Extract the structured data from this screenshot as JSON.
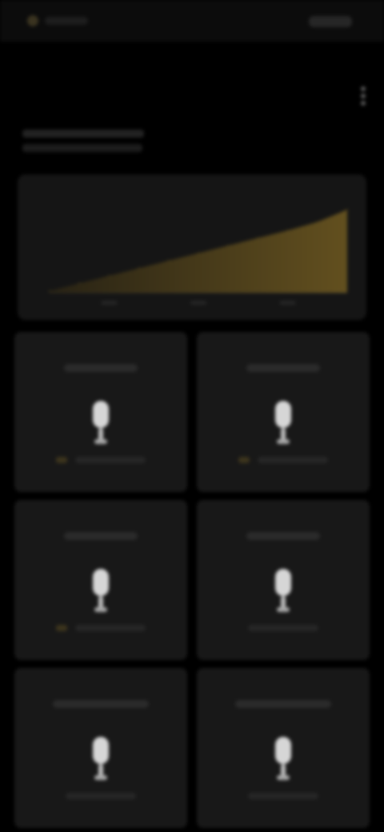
{
  "status_bar": {
    "indicator_icon": "status-dot-icon"
  },
  "header": {
    "title_part1": "",
    "title_part2": "",
    "menu_icon": "more-vertical-icon"
  },
  "colors": {
    "background": "#000000",
    "card": "#181818",
    "chart_card": "#151515",
    "accent": "#6b5620",
    "text_primary": "#e6e6e6",
    "text_muted": "#9d9d9d"
  },
  "chart_data": {
    "type": "area",
    "x": [
      0,
      1,
      2,
      3,
      4,
      5,
      6,
      7,
      8,
      9,
      10
    ],
    "values": [
      2,
      10,
      18,
      26,
      34,
      42,
      50,
      58,
      66,
      75,
      88
    ],
    "ylim": [
      0,
      100
    ],
    "title": "",
    "xlabel": "",
    "ylabel": "",
    "grid": false
  },
  "tiles": [
    {
      "icon": "microphone-icon",
      "has_accent": true
    },
    {
      "icon": "microphone-icon",
      "has_accent": true
    },
    {
      "icon": "microphone-icon",
      "has_accent": true
    },
    {
      "icon": "microphone-icon",
      "has_accent": false
    },
    {
      "icon": "microphone-icon",
      "has_accent": false
    },
    {
      "icon": "microphone-icon",
      "has_accent": false
    }
  ]
}
